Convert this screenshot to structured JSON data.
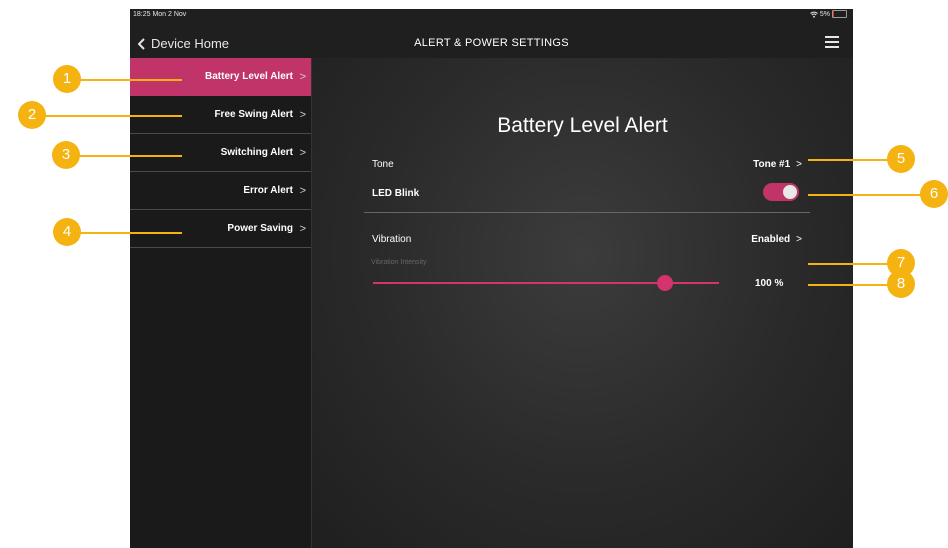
{
  "status_bar": {
    "time": "18:25  Mon 2 Nov",
    "wifi_icon": "wifi-icon",
    "battery": "5%"
  },
  "nav": {
    "back_label": "Device Home",
    "title": "ALERT & POWER SETTINGS",
    "menu_icon": "hamburger-menu-icon"
  },
  "sidebar": {
    "items": [
      {
        "label": "Battery Level Alert",
        "chevron": ">"
      },
      {
        "label": "Free Swing Alert",
        "chevron": ">"
      },
      {
        "label": "Switching Alert",
        "chevron": ">"
      },
      {
        "label": "Error Alert",
        "chevron": ">"
      },
      {
        "label": "Power Saving",
        "chevron": ">"
      }
    ],
    "active_index": 0
  },
  "panel": {
    "title": "Battery Level Alert",
    "tone": {
      "label": "Tone",
      "value": "Tone #1",
      "chevron": ">"
    },
    "led_blink": {
      "label": "LED Blink",
      "enabled": true
    },
    "vibration": {
      "label": "Vibration",
      "value": "Enabled",
      "chevron": ">"
    },
    "vibration_intensity": {
      "label": "Vibration Intensity",
      "value": "100 %",
      "level": 1.0
    }
  },
  "callouts": [
    "1",
    "2",
    "3",
    "4",
    "5",
    "6",
    "7",
    "8"
  ],
  "colors": {
    "accent": "#c0346a",
    "callout": "#f5b312",
    "background": "#1f1f1f"
  }
}
